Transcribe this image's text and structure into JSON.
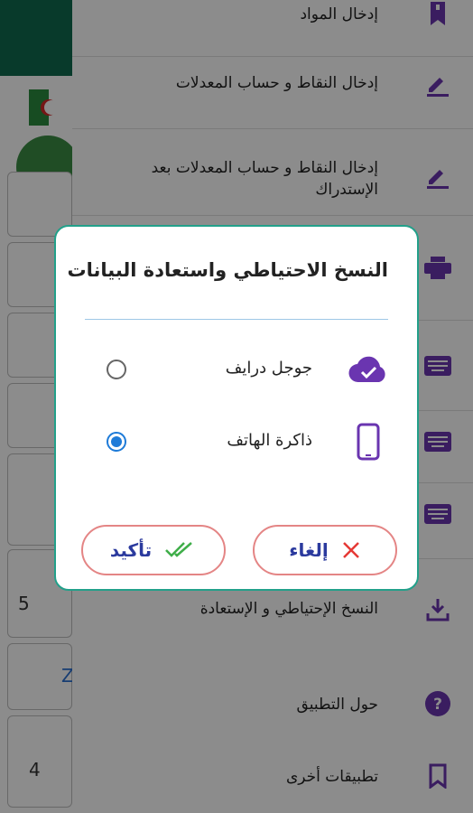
{
  "menu": {
    "items": [
      {
        "label": "إدخال المواد",
        "icon": "bookmark-icon"
      },
      {
        "label": "إدخال النقاط و حساب المعدلات",
        "icon": "edit-icon"
      },
      {
        "label": "إدخال النقاط و حساب المعدلات بعد الإستدراك",
        "icon": "edit-icon"
      },
      {
        "label": "",
        "icon": "print-icon"
      },
      {
        "label": "",
        "icon": "keyboard-icon"
      },
      {
        "label": "",
        "icon": "keyboard-icon"
      },
      {
        "label": "",
        "icon": "keyboard-icon"
      },
      {
        "label": "النسخ الإحتياطي و الإستعادة",
        "icon": "download-icon"
      },
      {
        "label": "حول التطبيق",
        "icon": "help-icon"
      },
      {
        "label": "تطبيقات أخرى",
        "icon": "bookmark-outline-icon"
      }
    ]
  },
  "background_app": {
    "row_numbers": [
      "5",
      "4"
    ],
    "row_letter": "Z"
  },
  "dialog": {
    "title": "النسخ الاحتياطي واستعادة البيانات",
    "options": [
      {
        "label": "جوجل درايف",
        "icon": "cloud-done-icon",
        "selected": false
      },
      {
        "label": "ذاكرة الهاتف",
        "icon": "smartphone-icon",
        "selected": true
      }
    ],
    "confirm_label": "تأكيد",
    "cancel_label": "إلغاء"
  },
  "colors": {
    "accent": "#6a35b0",
    "dialog_border": "#22a08a",
    "button_border": "#e48585",
    "button_text": "#2b3a9e",
    "radio_selected": "#1e7bd8",
    "confirm_check": "#3fae49",
    "cancel_x": "#e53935"
  }
}
